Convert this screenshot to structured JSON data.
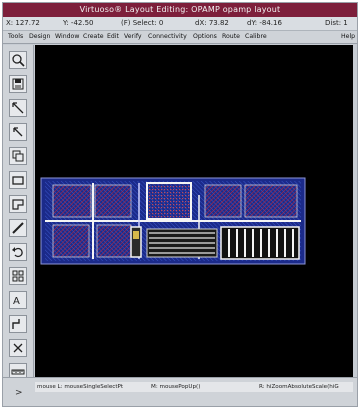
{
  "window": {
    "title": "Virtuoso® Layout Editing: OPAMP opamp layout"
  },
  "status": {
    "x": "X: 127.72",
    "y": "Y: -42.50",
    "select": "(F) Select: 0",
    "dx": "dX: 73.82",
    "dy": "dY: -84.16",
    "dist": "Dist: 1"
  },
  "menu": [
    "Tools",
    "Design",
    "Window",
    "Create",
    "Edit",
    "Verify",
    "Connectivity",
    "Options",
    "Route",
    "Calibre",
    "Help"
  ],
  "toolbar": [
    "zoom-in-icon",
    "save-icon",
    "stretch-icon",
    "move-icon",
    "copy-icon",
    "rectangle-icon",
    "polygon-icon",
    "path-icon",
    "undo-icon",
    "instance-icon",
    "label-icon",
    "wire-icon",
    "delete-icon",
    "ruler-icon",
    "properties-icon"
  ],
  "prompt": {
    "left": "mouse L: mouseSingleSelectPt",
    "middle": "M: mousePopUp()",
    "right": "R: hiZoomAbsoluteScale(hiG"
  },
  "cmd_prompt": ">",
  "colors": {
    "title_bg": "#7d1f3b",
    "canvas_bg": "#000000",
    "metal_blue": "#2c3ea8",
    "poly_red": "#b3263d",
    "white": "#f4f4f4"
  }
}
